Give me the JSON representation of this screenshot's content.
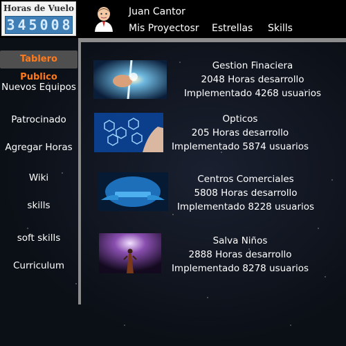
{
  "logo": {
    "title": "Horas de Vuelo",
    "digits": [
      "3",
      "4",
      "5",
      "0",
      "0",
      "8"
    ]
  },
  "user": {
    "name": "Juan Cantor"
  },
  "nav": [
    "Mis Proyectosr",
    "Estrellas",
    "Skills"
  ],
  "sidebar": [
    {
      "label": "Tablero Publico",
      "active": true
    },
    {
      "label": "Nuevos Equipos"
    },
    {
      "label": "Patrocinado"
    },
    {
      "label": "Agregar Horas"
    },
    {
      "label": "Wiki"
    },
    {
      "label": "skills"
    },
    {
      "label": "soft skills"
    },
    {
      "label": "Curriculum"
    }
  ],
  "projects": [
    {
      "title": "Gestion Finaciera",
      "hours": "2048 Horas desarrollo",
      "users": "Implementado 4268 usuarios"
    },
    {
      "title": "Opticos",
      "hours": "205 Horas desarrollo",
      "users": "Implementado 5874 usuarios"
    },
    {
      "title": "Centros Comerciales",
      "hours": "5808 Horas desarrollo",
      "users": "Implementado 8228 usuarios"
    },
    {
      "title": "Salva Niños",
      "hours": "2888 Horas desarrollo",
      "users": "Implementado 8278 usuarios"
    }
  ],
  "colors": {
    "accent": "#ff7a1a",
    "divider": "#8c8c8c",
    "counter": "#3f7fb5"
  }
}
